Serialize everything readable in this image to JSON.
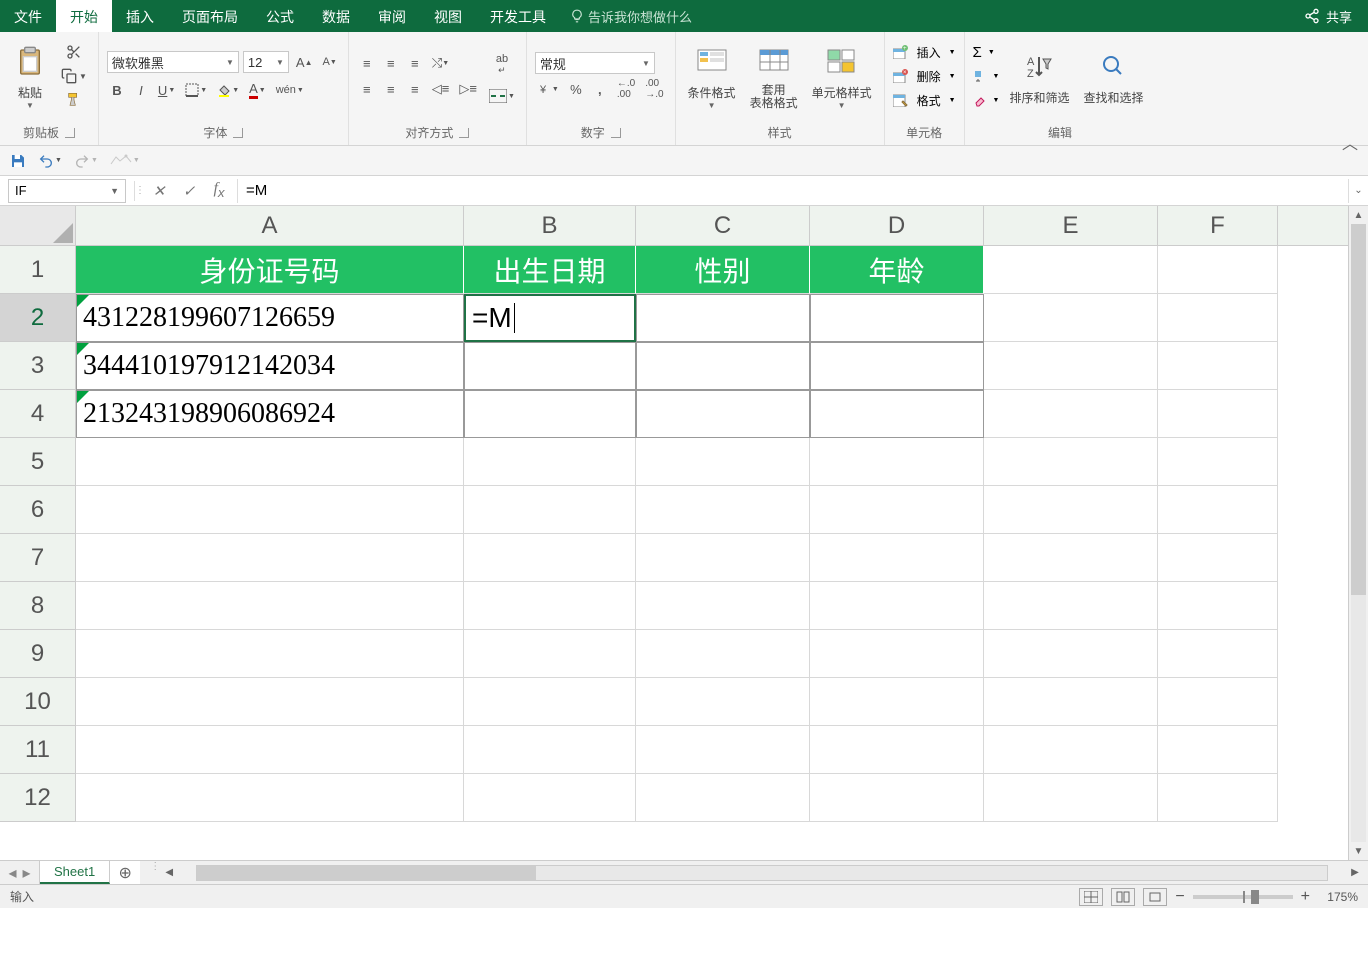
{
  "tabs": {
    "file": "文件",
    "home": "开始",
    "insert": "插入",
    "pageLayout": "页面布局",
    "formulas": "公式",
    "data": "数据",
    "review": "审阅",
    "view": "视图",
    "developer": "开发工具",
    "tellMe": "告诉我你想做什么"
  },
  "share": "共享",
  "ribbon": {
    "clipboard": {
      "label": "剪贴板",
      "paste": "粘贴"
    },
    "font": {
      "label": "字体",
      "fontName": "微软雅黑",
      "fontSize": "12"
    },
    "alignment": {
      "label": "对齐方式"
    },
    "number": {
      "label": "数字",
      "format": "常规"
    },
    "styles": {
      "label": "样式",
      "conditional": "条件格式",
      "formatTable": "套用\n表格格式",
      "cellStyles": "单元格样式"
    },
    "cells": {
      "label": "单元格",
      "insert": "插入",
      "delete": "删除",
      "format": "格式"
    },
    "editing": {
      "label": "编辑",
      "sortFilter": "排序和筛选",
      "findSelect": "查找和选择"
    }
  },
  "nameBox": "IF",
  "formula": "=M",
  "sheet": {
    "columns": [
      "A",
      "B",
      "C",
      "D",
      "E",
      "F"
    ],
    "rows": [
      "1",
      "2",
      "3",
      "4",
      "5",
      "6",
      "7",
      "8",
      "9",
      "10",
      "11",
      "12"
    ],
    "headers": {
      "A": "身份证号码",
      "B": "出生日期",
      "C": "性别",
      "D": "年龄"
    },
    "data": {
      "A2": "431228199607126659",
      "A3": "344410197912142034",
      "A4": "213243198906086924",
      "B2": "=M"
    },
    "activeCell": "B2"
  },
  "sheetTab": "Sheet1",
  "status": "输入",
  "zoom": "175%"
}
